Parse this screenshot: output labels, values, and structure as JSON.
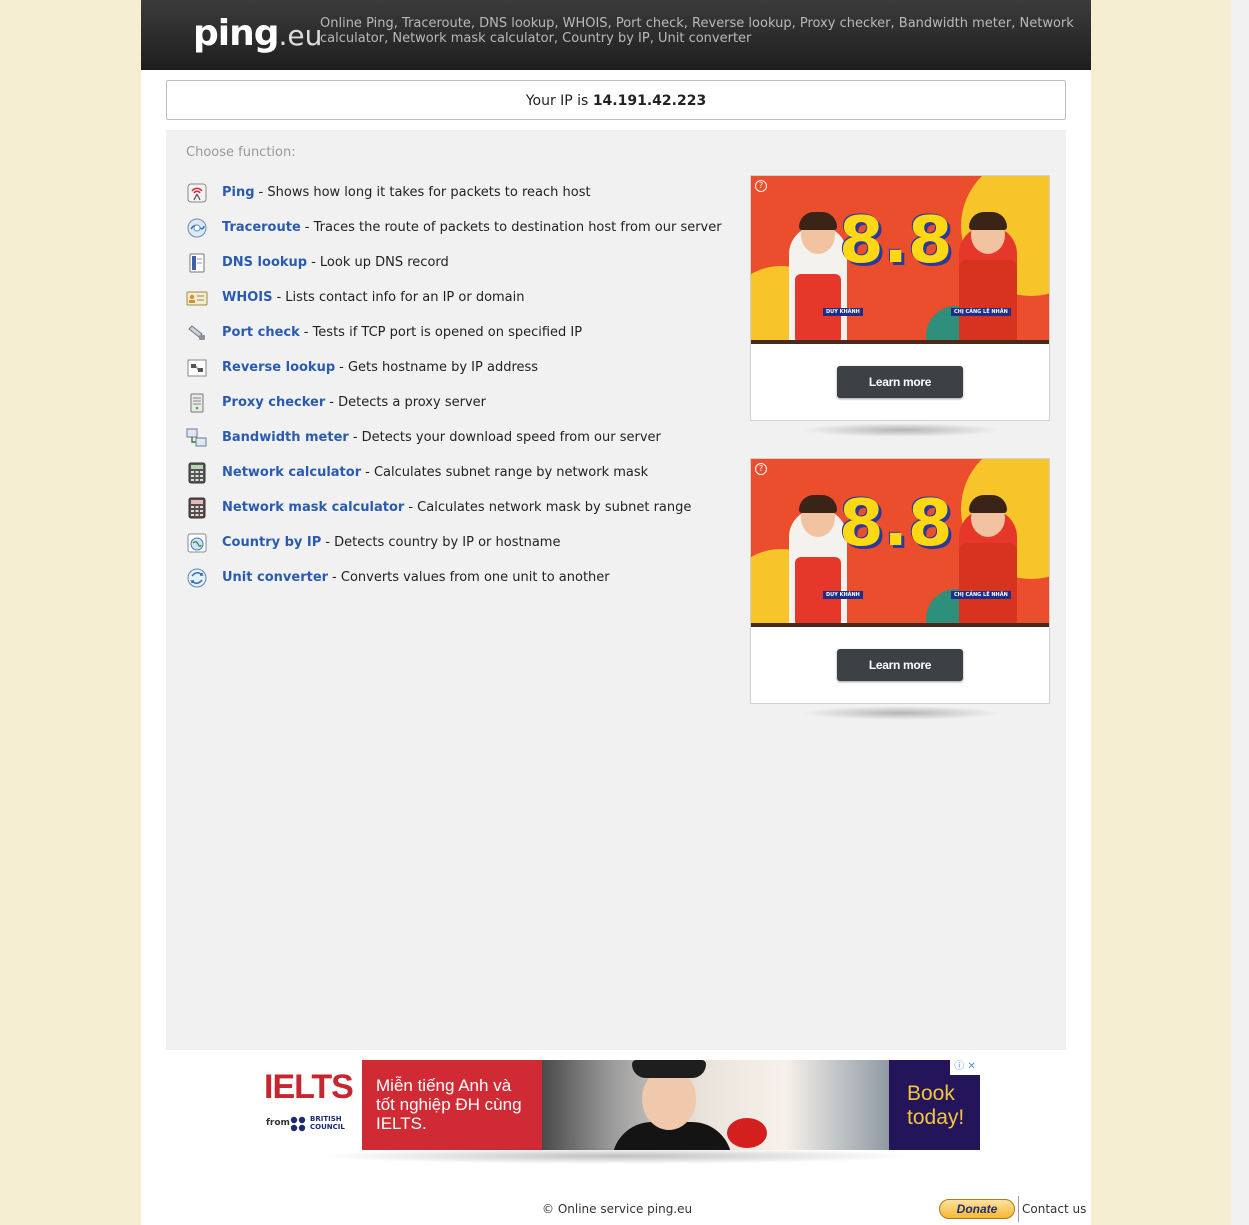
{
  "header": {
    "logo_main": "ping",
    "logo_tld": ".eu",
    "tagline": "Online Ping, Traceroute, DNS lookup, WHOIS, Port check, Reverse lookup, Proxy checker, Bandwidth meter, Network calculator, Network mask calculator, Country by IP, Unit converter"
  },
  "ip": {
    "label": "Your IP is",
    "value": "14.191.42.223"
  },
  "main": {
    "choose_label": "Choose function:",
    "functions": [
      {
        "name": "Ping",
        "desc": "- Shows how long it takes for packets to reach host",
        "icon": "ping-icon"
      },
      {
        "name": "Traceroute",
        "desc": "- Traces the route of packets to destination host from our server",
        "icon": "traceroute-icon"
      },
      {
        "name": "DNS lookup",
        "desc": "- Look up DNS record",
        "icon": "dns-icon"
      },
      {
        "name": "WHOIS",
        "desc": "- Lists contact info for an IP or domain",
        "icon": "whois-icon"
      },
      {
        "name": "Port check",
        "desc": "- Tests if TCP port is opened on specified IP",
        "icon": "port-icon"
      },
      {
        "name": "Reverse lookup",
        "desc": "- Gets hostname by IP address",
        "icon": "reverse-icon"
      },
      {
        "name": "Proxy checker",
        "desc": "- Detects a proxy server",
        "icon": "proxy-icon"
      },
      {
        "name": "Bandwidth meter",
        "desc": "- Detects your download speed from our server",
        "icon": "bandwidth-icon"
      },
      {
        "name": "Network calculator",
        "desc": "- Calculates subnet range by network mask",
        "icon": "calculator-icon"
      },
      {
        "name": "Network mask calculator",
        "desc": "- Calculates network mask by subnet range",
        "icon": "mask-calculator-icon"
      },
      {
        "name": "Country by IP",
        "desc": "- Detects country by IP or hostname",
        "icon": "country-icon"
      },
      {
        "name": "Unit converter",
        "desc": "- Converts values from one unit to another",
        "icon": "converter-icon"
      }
    ]
  },
  "ads": {
    "side": [
      {
        "headline": "8.8",
        "tag_left": "DUY KHÁNH",
        "tag_right": "CHỊ CẢNG LÊ NHÂN",
        "button": "Learn more"
      },
      {
        "headline": "8.8",
        "tag_left": "DUY KHÁNH",
        "tag_right": "CHỊ CẢNG LÊ NHÂN",
        "button": "Learn more"
      }
    ],
    "bottom": {
      "brand": "IELTS",
      "from": "from",
      "partner_line1": "BRITISH",
      "partner_line2": "COUNCIL",
      "message": "Miễn tiếng Anh và tốt nghiệp ĐH cùng IELTS.",
      "cta": "Book today!",
      "adchoices": "ⓘ ✕"
    }
  },
  "footer": {
    "copyright": "© Online service ping.eu",
    "donate": "Donate",
    "contact": "Contact us"
  },
  "colors": {
    "page_bg": "#f5eed3",
    "header_bg": "#2a2a2a",
    "link": "#2a5bb0",
    "panel_bg": "#f1f1f1"
  }
}
